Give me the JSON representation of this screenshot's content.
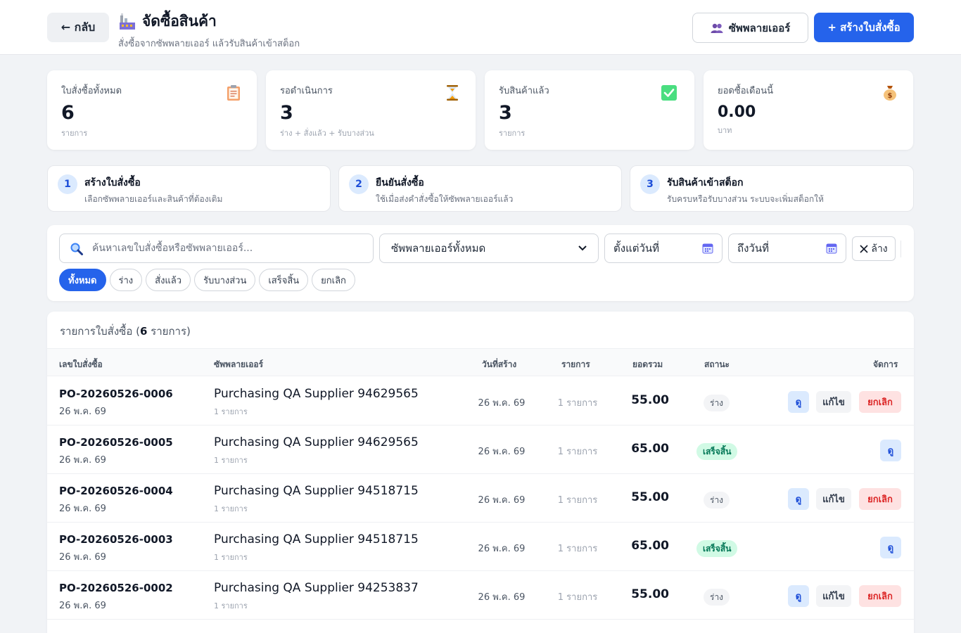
{
  "header": {
    "back_label": "← กลับ",
    "title": "จัดซื้อสินค้า",
    "subtitle": "สั่งซื้อจากซัพพลายเออร์ แล้วรับสินค้าเข้าสต็อก",
    "suppliers_label": "ซัพพลายเออร์",
    "create_label": "+ สร้างใบสั่งซื้อ"
  },
  "stats": [
    {
      "label": "ใบสั่งซื้อทั้งหมด",
      "value": "6",
      "sub": "รายการ",
      "icon": "clipboard-icon"
    },
    {
      "label": "รอดำเนินการ",
      "value": "3",
      "sub": "ร่าง + สั่งแล้ว + รับบางส่วน",
      "icon": "hourglass-icon"
    },
    {
      "label": "รับสินค้าแล้ว",
      "value": "3",
      "sub": "รายการ",
      "icon": "check-icon"
    },
    {
      "label": "ยอดซื้อเดือนนี้",
      "value": "0.00",
      "sub": "บาท",
      "icon": "money-bag-icon"
    }
  ],
  "steps": [
    {
      "num": "1",
      "title": "สร้างใบสั่งซื้อ",
      "desc": "เลือกซัพพลายเออร์และสินค้าที่ต้องเติม"
    },
    {
      "num": "2",
      "title": "ยืนยันสั่งซื้อ",
      "desc": "ใช้เมื่อส่งคำสั่งซื้อให้ซัพพลายเออร์แล้ว"
    },
    {
      "num": "3",
      "title": "รับสินค้าเข้าสต็อก",
      "desc": "รับครบหรือรับบางส่วน ระบบจะเพิ่มสต็อกให้"
    }
  ],
  "filters": {
    "search_placeholder": "ค้นหาเลขใบสั่งซื้อหรือซัพพลายเออร์...",
    "supplier_selected": "ซัพพลายเออร์ทั้งหมด",
    "date_from": "ตั้งแต่วันที่",
    "date_to": "ถึงวันที่",
    "clear_label": "ล้าง",
    "status_pills": [
      "ทั้งหมด",
      "ร่าง",
      "สั่งแล้ว",
      "รับบางส่วน",
      "เสร็จสิ้น",
      "ยกเลิก"
    ],
    "active_pill": 0
  },
  "table": {
    "title_prefix": "รายการใบสั่งซื้อ (",
    "title_count": "6",
    "title_suffix": " รายการ)",
    "columns": {
      "po_number": "เลขใบสั่งซื้อ",
      "supplier": "ซัพพลายเออร์",
      "created": "วันที่สร้าง",
      "items": "รายการ",
      "total": "ยอดรวม",
      "status": "สถานะ",
      "actions": "จัดการ"
    },
    "actions": {
      "view": "ดู",
      "edit": "แก้ไข",
      "cancel": "ยกเลิก"
    },
    "rows": [
      {
        "po": "PO-20260526-0006",
        "date": "26 พ.ค. 69",
        "supplier": "Purchasing QA Supplier 94629565",
        "supplier_items": "1 รายการ",
        "created": "26 พ.ค. 69",
        "items": "1 รายการ",
        "total": "55.00",
        "status": "ร่าง",
        "status_type": "draft"
      },
      {
        "po": "PO-20260526-0005",
        "date": "26 พ.ค. 69",
        "supplier": "Purchasing QA Supplier 94629565",
        "supplier_items": "1 รายการ",
        "created": "26 พ.ค. 69",
        "items": "1 รายการ",
        "total": "65.00",
        "status": "เสร็จสิ้น",
        "status_type": "done"
      },
      {
        "po": "PO-20260526-0004",
        "date": "26 พ.ค. 69",
        "supplier": "Purchasing QA Supplier 94518715",
        "supplier_items": "1 รายการ",
        "created": "26 พ.ค. 69",
        "items": "1 รายการ",
        "total": "55.00",
        "status": "ร่าง",
        "status_type": "draft"
      },
      {
        "po": "PO-20260526-0003",
        "date": "26 พ.ค. 69",
        "supplier": "Purchasing QA Supplier 94518715",
        "supplier_items": "1 รายการ",
        "created": "26 พ.ค. 69",
        "items": "1 รายการ",
        "total": "65.00",
        "status": "เสร็จสิ้น",
        "status_type": "done"
      },
      {
        "po": "PO-20260526-0002",
        "date": "26 พ.ค. 69",
        "supplier": "Purchasing QA Supplier 94253837",
        "supplier_items": "1 รายการ",
        "created": "26 พ.ค. 69",
        "items": "1 รายการ",
        "total": "55.00",
        "status": "ร่าง",
        "status_type": "draft"
      }
    ]
  },
  "colors": {
    "accent": "#2563eb",
    "done_bg": "#d1fae5",
    "done_text": "#047857",
    "cancel_bg": "#fee2e2",
    "cancel_text": "#dc2626"
  }
}
